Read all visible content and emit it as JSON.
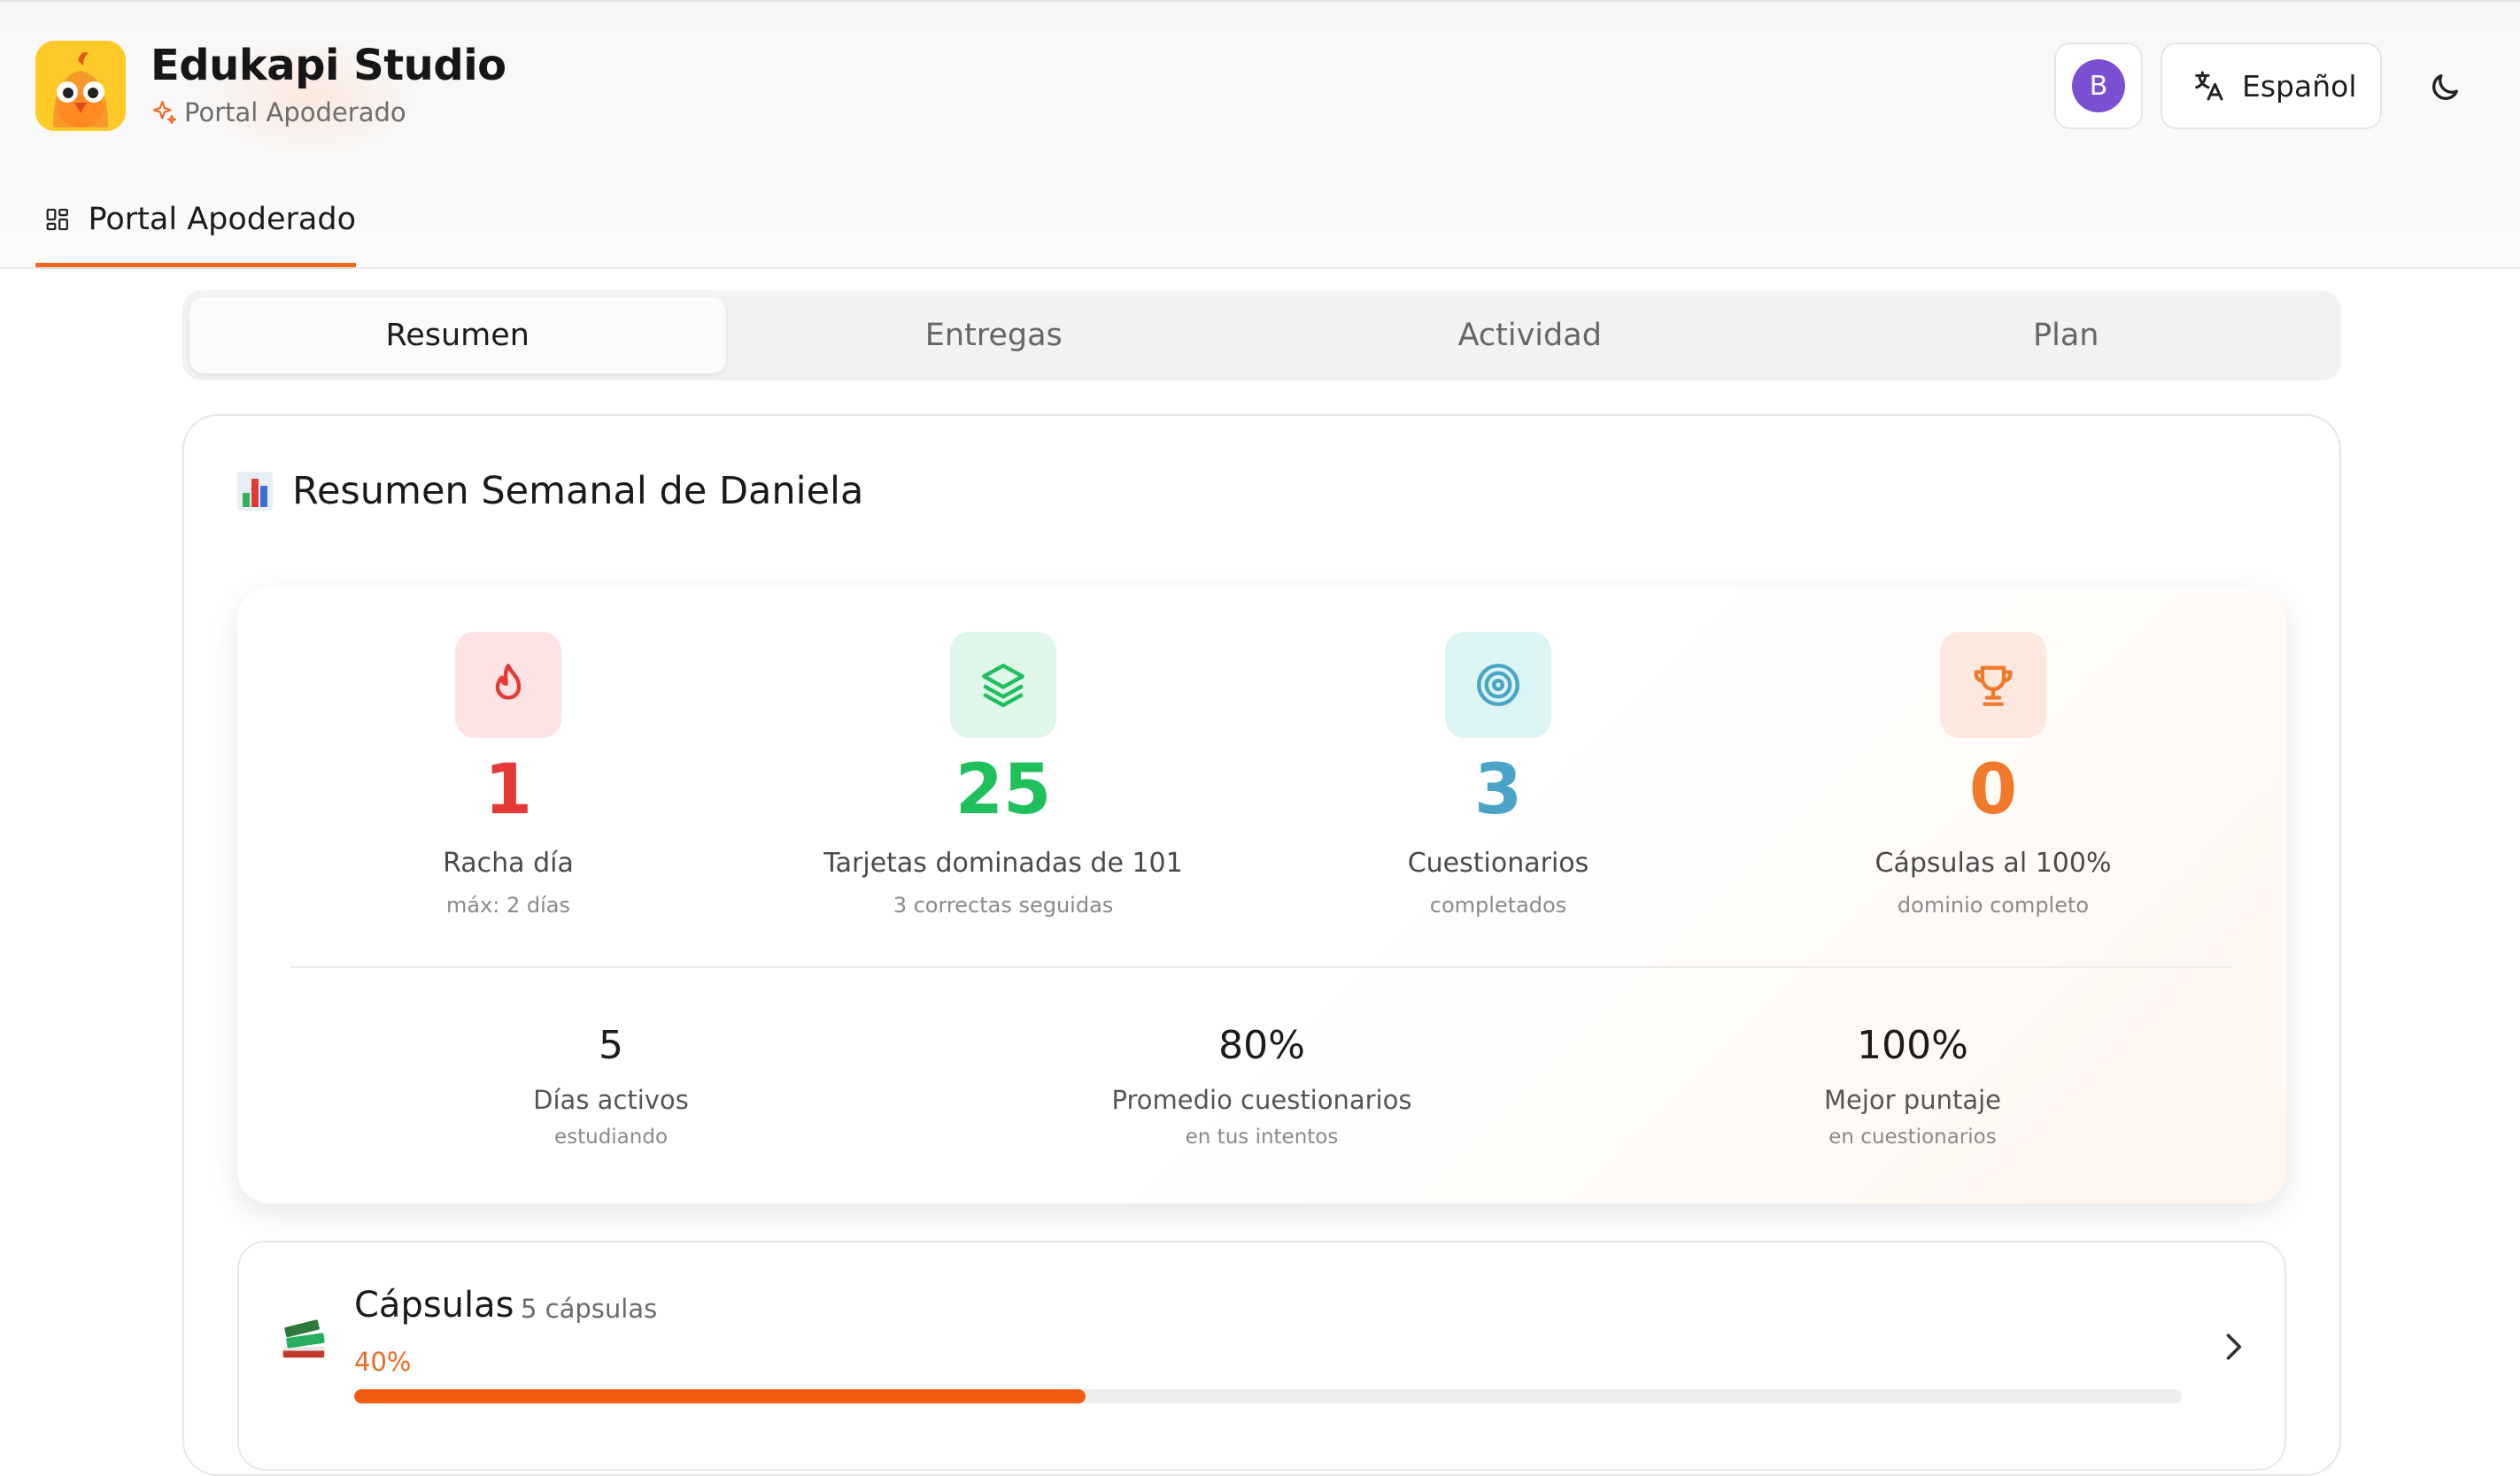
{
  "header": {
    "app_title": "Edukapi Studio",
    "app_subtitle": "Portal Apoderado",
    "avatar_initial": "B",
    "language_label": "Español",
    "nav_tab_label": "Portal Apoderado",
    "accent_color": "#f06a1e"
  },
  "tabs": [
    {
      "label": "Resumen",
      "active": true
    },
    {
      "label": "Entregas",
      "active": false
    },
    {
      "label": "Actividad",
      "active": false
    },
    {
      "label": "Plan",
      "active": false
    }
  ],
  "summary": {
    "title": "Resumen Semanal de Daniela",
    "stats": [
      {
        "icon": "flame-icon",
        "value": "1",
        "label": "Racha día",
        "sub": "máx: 2 días",
        "color": "#e53935",
        "bg": "#fde3e3"
      },
      {
        "icon": "layers-icon",
        "value": "25",
        "label": "Tarjetas dominadas de 101",
        "sub": "3 correctas seguidas",
        "color": "#1fbf5c",
        "bg": "#dff6ea"
      },
      {
        "icon": "target-icon",
        "value": "3",
        "label": "Cuestionarios",
        "sub": "completados",
        "color": "#4aa3c8",
        "bg": "#dcf4f3"
      },
      {
        "icon": "trophy-icon",
        "value": "0",
        "label": "Cápsulas al 100%",
        "sub": "dominio completo",
        "color": "#f07a2a",
        "bg": "#fde8df"
      }
    ],
    "metrics": [
      {
        "value": "5",
        "label": "Días activos",
        "sub": "estudiando"
      },
      {
        "value": "80%",
        "label": "Promedio cuestionarios",
        "sub": "en tus intentos"
      },
      {
        "value": "100%",
        "label": "Mejor puntaje",
        "sub": "en cuestionarios"
      }
    ]
  },
  "capsules": {
    "title": "Cápsulas",
    "count": "5 cápsulas",
    "progress_label": "40%",
    "progress": 0.4
  }
}
